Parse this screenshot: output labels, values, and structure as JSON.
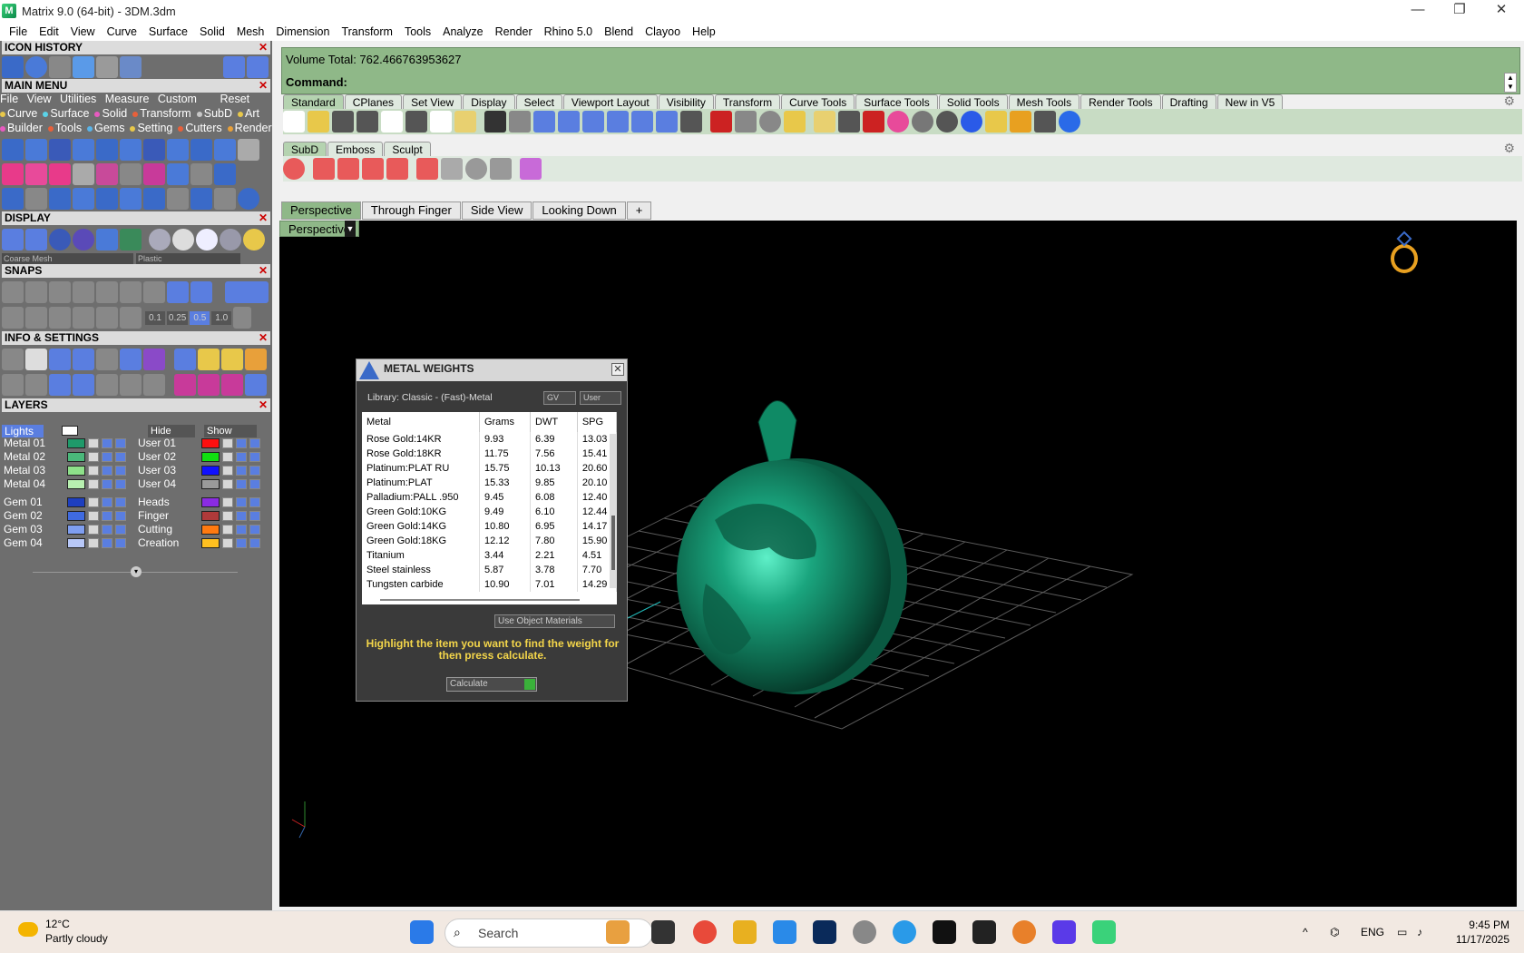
{
  "window": {
    "title": "Matrix 9.0 (64-bit) - 3DM.3dm",
    "minimize": "—",
    "maximize": "❐",
    "close": "✕"
  },
  "menubar": [
    "File",
    "Edit",
    "View",
    "Curve",
    "Surface",
    "Solid",
    "Mesh",
    "Dimension",
    "Transform",
    "Tools",
    "Analyze",
    "Render",
    "Rhino 5.0",
    "Blend",
    "Clayoo",
    "Help"
  ],
  "left": {
    "icon_history": "ICON HISTORY",
    "main_menu": "MAIN MENU",
    "mm_row1": [
      "File",
      "View",
      "Utilities",
      "Measure",
      "Custom",
      "Reset"
    ],
    "mm_row2": [
      {
        "label": "Curve",
        "color": "#e8c84a"
      },
      {
        "label": "Surface",
        "color": "#5ad3e8"
      },
      {
        "label": "Solid",
        "color": "#e85ac0"
      },
      {
        "label": "Transform",
        "color": "#e8603a"
      },
      {
        "label": "SubD",
        "color": "#c8c8c8"
      },
      {
        "label": "Art",
        "color": "#e8c84a"
      }
    ],
    "mm_row3": [
      {
        "label": "Builder",
        "color": "#e85ac0"
      },
      {
        "label": "Tools",
        "color": "#e8603a"
      },
      {
        "label": "Gems",
        "color": "#5ab4e8"
      },
      {
        "label": "Setting",
        "color": "#e8c84a"
      },
      {
        "label": "Cutters",
        "color": "#e8603a"
      },
      {
        "label": "Render",
        "color": "#e8a03a"
      }
    ],
    "display": "DISPLAY",
    "display_mesh": "Coarse Mesh",
    "display_mat": "Plastic",
    "snaps": "SNAPS",
    "snap_values": [
      "0.1",
      "0.25",
      "0.5",
      "1.0"
    ],
    "info_settings": "INFO & SETTINGS",
    "layers": "LAYERS",
    "lights": "Lights",
    "hide": "Hide",
    "show": "Show",
    "layers_left": [
      {
        "name": "Metal 01",
        "color": "#1f9a6a"
      },
      {
        "name": "Metal 02",
        "color": "#4ab87a"
      },
      {
        "name": "Metal 03",
        "color": "#8ee08a"
      },
      {
        "name": "Metal 04",
        "color": "#b8f0b0"
      },
      {
        "name": "Gem 01",
        "color": "#1e3fbf"
      },
      {
        "name": "Gem 02",
        "color": "#3f6ae0"
      },
      {
        "name": "Gem 03",
        "color": "#7f9ef0"
      },
      {
        "name": "Gem 04",
        "color": "#b8c8f8"
      }
    ],
    "layers_right": [
      {
        "name": "User 01",
        "color": "#ff1010"
      },
      {
        "name": "User 02",
        "color": "#10e010"
      },
      {
        "name": "User 03",
        "color": "#1010ff"
      },
      {
        "name": "User 04",
        "color": "#9a9a9a"
      },
      {
        "name": "Heads",
        "color": "#8a2be2"
      },
      {
        "name": "Finger",
        "color": "#b03a3a"
      },
      {
        "name": "Cutting",
        "color": "#ff7a10"
      },
      {
        "name": "Creation",
        "color": "#ffc020"
      }
    ]
  },
  "command": {
    "volume": "Volume Total: 762.466763953627",
    "prompt": "Command:"
  },
  "toolbar_tabs": [
    "Standard",
    "CPlanes",
    "Set View",
    "Display",
    "Select",
    "Viewport Layout",
    "Visibility",
    "Transform",
    "Curve Tools",
    "Surface Tools",
    "Solid Tools",
    "Mesh Tools",
    "Render Tools",
    "Drafting",
    "New in V5"
  ],
  "subd_tabs": [
    "SubD",
    "Emboss",
    "Sculpt"
  ],
  "view_tabs": [
    "Perspective",
    "Through Finger",
    "Side View",
    "Looking Down",
    "+"
  ],
  "viewport_label": "Perspective",
  "metal_weights": {
    "title": "METAL WEIGHTS",
    "library": "Library: Classic - (Fast)-Metal",
    "gv": "GV",
    "user": "User",
    "columns": [
      "Metal",
      "Grams",
      "DWT",
      "SPG"
    ],
    "rows": [
      [
        "Rose Gold:14KR",
        "9.93",
        "6.39",
        "13.03"
      ],
      [
        "Rose Gold:18KR",
        "11.75",
        "7.56",
        "15.41"
      ],
      [
        "Platinum:PLAT RU",
        "15.75",
        "10.13",
        "20.60"
      ],
      [
        "Platinum:PLAT",
        "15.33",
        "9.85",
        "20.10"
      ],
      [
        "Palladium:PALL .950",
        "9.45",
        "6.08",
        "12.40"
      ],
      [
        "Green Gold:10KG",
        "9.49",
        "6.10",
        "12.44"
      ],
      [
        "Green Gold:14KG",
        "10.80",
        "6.95",
        "14.17"
      ],
      [
        "Green Gold:18KG",
        "12.12",
        "7.80",
        "15.90"
      ],
      [
        "Titanium",
        "3.44",
        "2.21",
        "4.51"
      ],
      [
        "Steel stainless",
        "5.87",
        "3.78",
        "7.70"
      ],
      [
        "Tungsten carbide",
        "10.90",
        "7.01",
        "14.29"
      ]
    ],
    "use_object_materials": "Use Object Materials",
    "hint": "Highlight the item you want to find the weight for then press calculate.",
    "calculate": "Calculate"
  },
  "taskbar": {
    "weather_temp": "12°C",
    "weather_desc": "Partly cloudy",
    "search": "Search",
    "lang": "ENG",
    "time": "9:45 PM",
    "date": "11/17/2025"
  }
}
